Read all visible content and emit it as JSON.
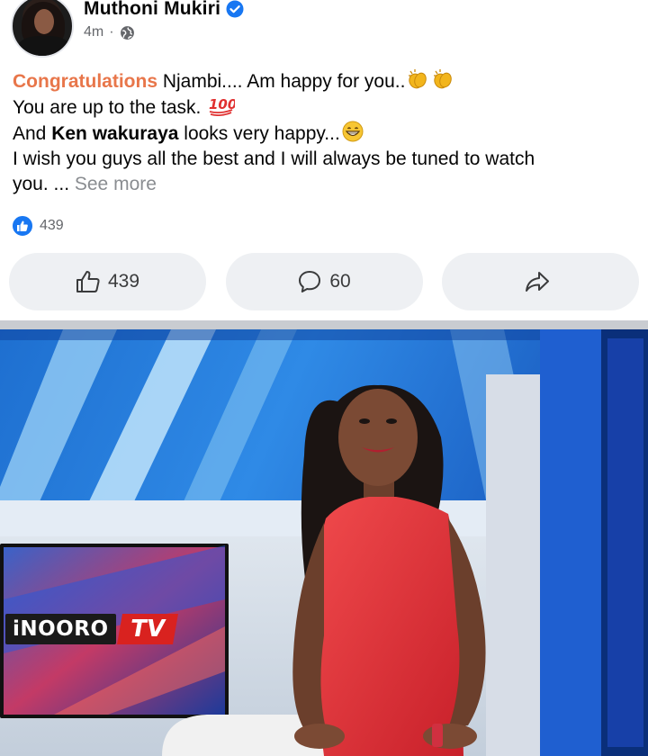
{
  "author": {
    "name": "Muthoni  Mukiri",
    "verified": true,
    "time": "4m",
    "separator": "·",
    "audience_icon": "globe-icon"
  },
  "post": {
    "congrats_word": "Congratulations",
    "line1_rest": " Njambi.... Am happy for you..",
    "line2": "You are up to the task. ",
    "line3_prefix": " And ",
    "mention": "Ken wakuraya",
    "line3_rest": "  looks very happy...",
    "line4": "I wish you guys all the best and I will always be tuned to watch",
    "line5_prefix": "you. ... ",
    "see_more": "See more"
  },
  "reactions": {
    "icon": "like-icon",
    "count": "439"
  },
  "actions": {
    "like": {
      "icon": "thumbs-up-icon",
      "label": "439"
    },
    "comment": {
      "icon": "comment-icon",
      "label": "60"
    },
    "share": {
      "icon": "share-icon",
      "label": ""
    }
  },
  "photo": {
    "logo_left": "iNOORO",
    "logo_right": "TV"
  },
  "colors": {
    "congrats": "#e8764a",
    "brand_blue": "#1877f2",
    "button_bg": "#eef0f3",
    "muted": "#65676b",
    "dress_red": "#e2383e",
    "logo_red": "#d9221f"
  }
}
